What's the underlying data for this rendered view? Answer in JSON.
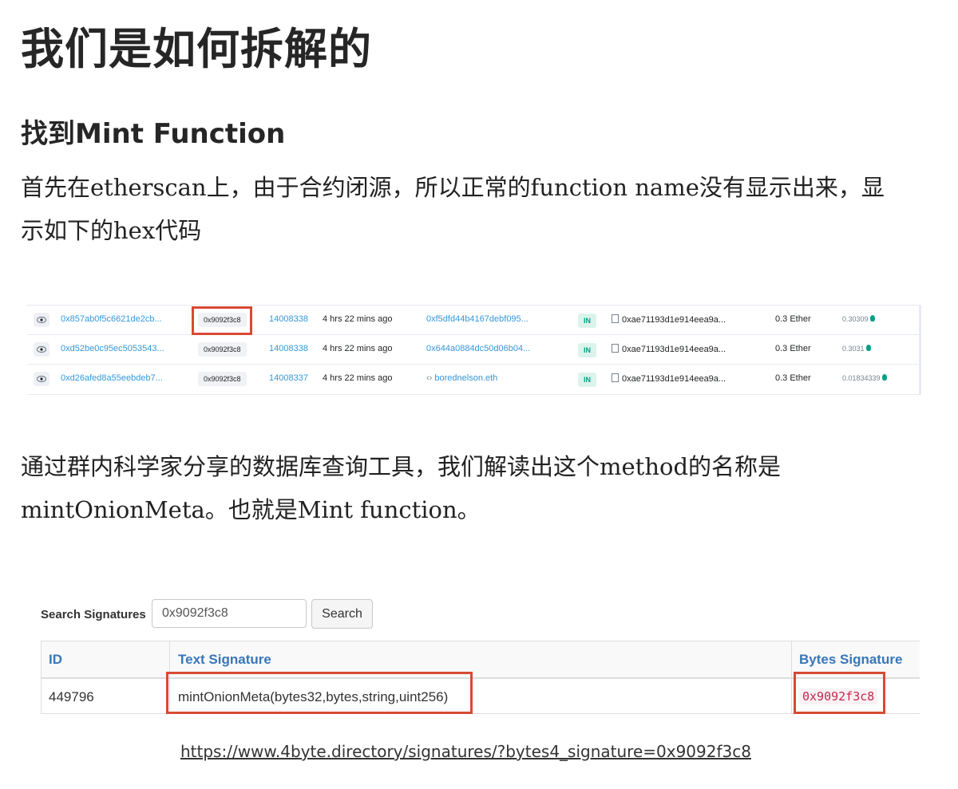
{
  "heading": "我们是如何拆解的",
  "subheading": "找到Mint Function",
  "paragraph1": "首先在etherscan上，由于合约闭源，所以正常的function name没有显示出来，显示如下的hex代码",
  "paragraph2": "通过群内科学家分享的数据库查询工具，我们解读出这个method的名称是mintOnionMeta。也就是Mint function。",
  "etherscan": {
    "rows": [
      {
        "tx_hash": "0x857ab0f5c6621de2cb...",
        "method": "0x9092f3c8",
        "block": "14008338",
        "age": "4 hrs 22 mins ago",
        "from": "0xf5dfd44b4167debf095...",
        "direction": "IN",
        "to": "0xae71193d1e914eea9a...",
        "value": "0.3 Ether",
        "fee": "0.30309"
      },
      {
        "tx_hash": "0xd52be0c95ec5053543...",
        "method": "0x9092f3c8",
        "block": "14008338",
        "age": "4 hrs 22 mins ago",
        "from": "0x644a0884dc50d06b04...",
        "direction": "IN",
        "to": "0xae71193d1e914eea9a...",
        "value": "0.3 Ether",
        "fee": "0.3031"
      },
      {
        "tx_hash": "0xd26afed8a55eebdeb7...",
        "method": "0x9092f3c8",
        "block": "14008337",
        "age": "4 hrs 22 mins ago",
        "from": "borednelson.eth",
        "direction": "IN",
        "to": "0xae71193d1e914eea9a...",
        "value": "0.3 Ether",
        "fee": "0.01834339"
      }
    ]
  },
  "fourbyte": {
    "search_label": "Search Signatures",
    "search_value": "0x9092f3c8",
    "search_button": "Search",
    "columns": [
      "ID",
      "Text Signature",
      "Bytes Signature"
    ],
    "row": {
      "id": "449796",
      "text_signature": "mintOnionMeta(bytes32,bytes,string,uint256)",
      "bytes_signature": "0x9092f3c8"
    }
  },
  "source_url": "https://www.4byte.directory/signatures/?bytes4_signature=0x9092f3c8",
  "colors": {
    "highlight": "#d84a33",
    "link": "#3498db",
    "table_header": "#3876b8"
  }
}
